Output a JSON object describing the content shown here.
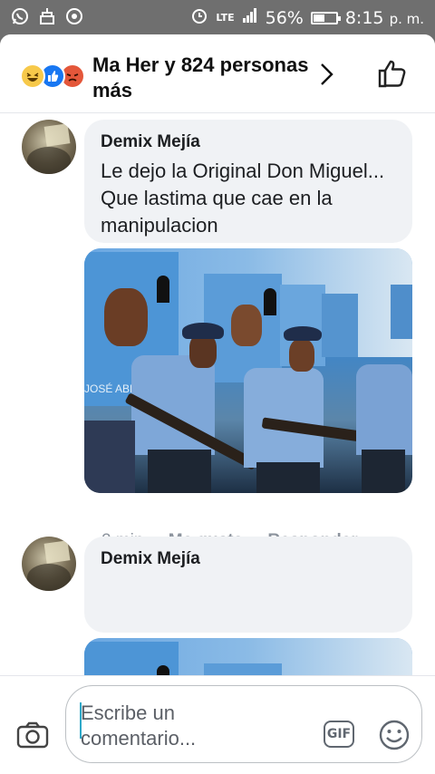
{
  "statusbar": {
    "network": "LTE",
    "battery": "56%",
    "battery_level": 0.56,
    "time": "8:15",
    "ampm": "p. m."
  },
  "header": {
    "title": "Ma Her y 824 personas más",
    "reactions": [
      "haha-icon",
      "like-icon",
      "angry-icon"
    ]
  },
  "comments": [
    {
      "author": "Demix Mejía",
      "text": "Le dejo la Original Don Miguel... Que lastima que cae en la manipulacion",
      "time": "2 min",
      "like_label": "Me gusta",
      "reply_label": "Responder",
      "photo_caption": "JOSÉ ABRAHAM MA"
    },
    {
      "author": "Demix Mejía",
      "text": ""
    }
  ],
  "composer": {
    "placeholder": "Escribe un comentario...",
    "gif_label": "GIF"
  },
  "colors": {
    "accent": "#1877f2",
    "bubble": "#f0f2f5",
    "meta_text": "#8d949e"
  }
}
